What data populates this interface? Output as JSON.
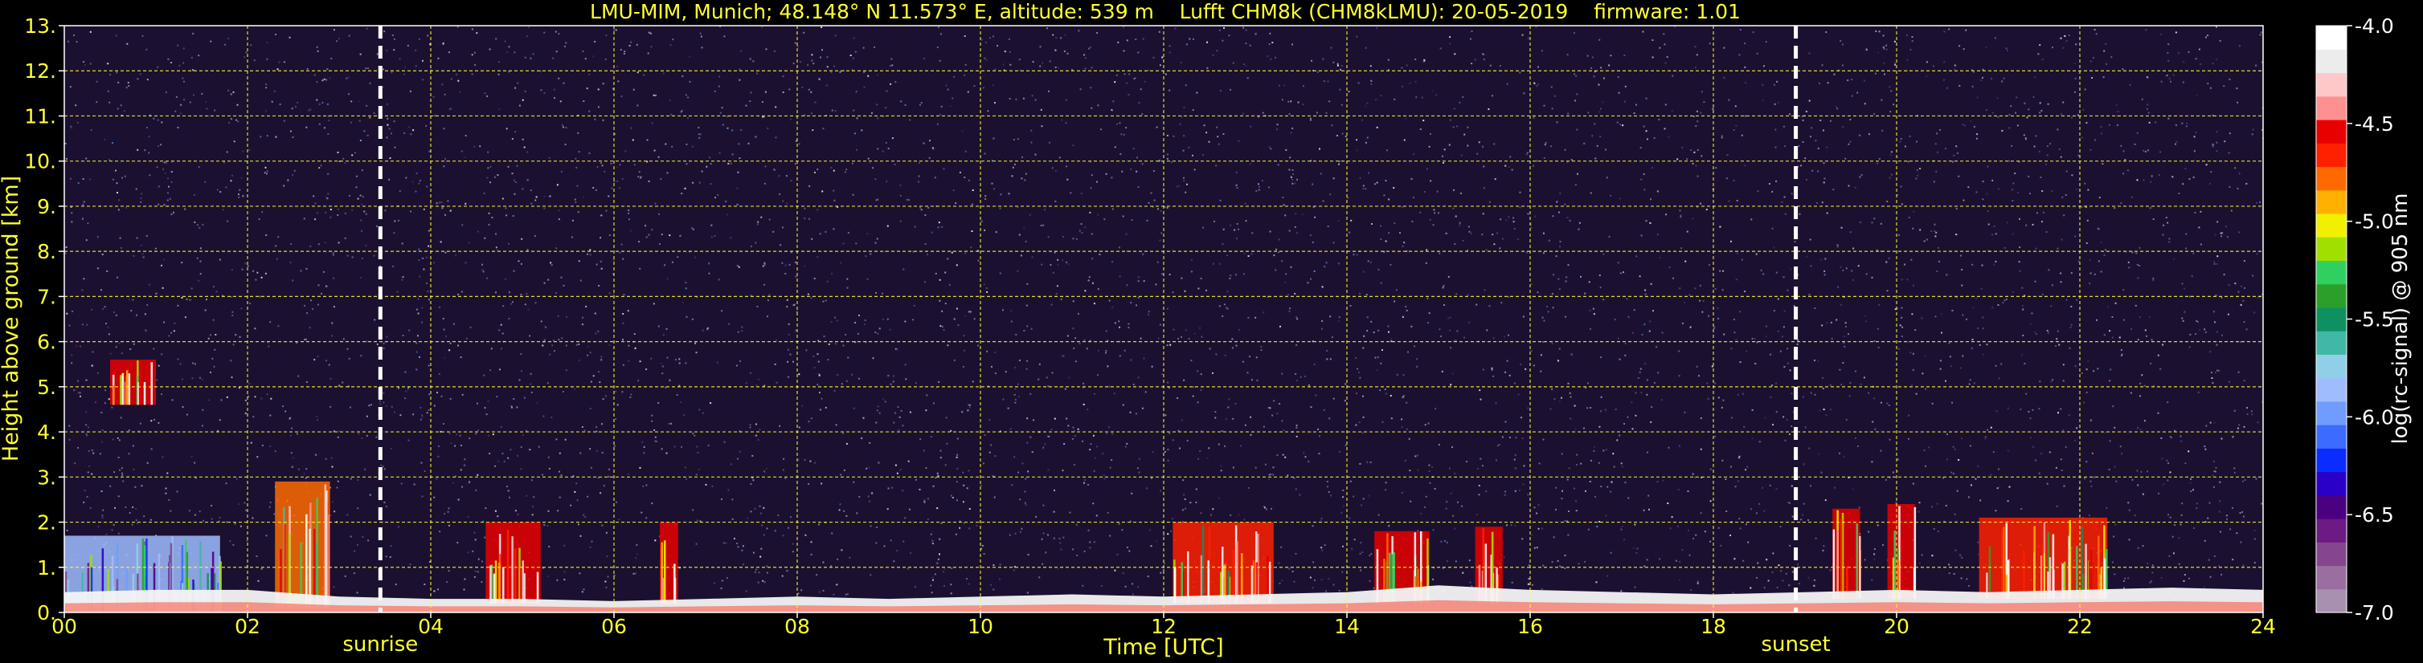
{
  "chart_data": {
    "type": "heatmap",
    "title": "LMU-MIM, Munich; 48.148° N 11.573° E, altitude: 539 m    Lufft CHM8k (CHM8kLMU): 20-05-2019    firmware: 1.01",
    "xlabel": "Time [UTC]",
    "ylabel": "Height above ground [km]",
    "xlim": [
      0,
      24
    ],
    "ylim": [
      0,
      13
    ],
    "x_ticks": [
      "00",
      "02",
      "04",
      "06",
      "08",
      "10",
      "12",
      "14",
      "16",
      "18",
      "20",
      "22",
      "24"
    ],
    "y_ticks": [
      "0.",
      "1.",
      "2.",
      "3.",
      "4.",
      "5.",
      "6.",
      "7.",
      "8.",
      "9.",
      "10.",
      "11.",
      "12.",
      "13."
    ],
    "grid": true,
    "colorbar": {
      "label": "log(rc-signal) @ 905 nm",
      "range": [
        -7.0,
        -4.0
      ],
      "ticks": [
        "-7.0",
        "-6.5",
        "-6.0",
        "-5.5",
        "-5.0",
        "-4.5",
        "-4.0"
      ],
      "tick_values": [
        -7.0,
        -6.5,
        -6.0,
        -5.5,
        -5.0,
        -4.5,
        -4.0
      ],
      "colors": [
        "#a890b0",
        "#9a6fa0",
        "#85468f",
        "#6d1a84",
        "#4b0082",
        "#2a00c8",
        "#0a2cff",
        "#3b6bff",
        "#6f9cff",
        "#9fbcff",
        "#8fd0e8",
        "#40b8a8",
        "#0f9060",
        "#2aa02a",
        "#30d060",
        "#a0e000",
        "#f0f000",
        "#ffb000",
        "#ff6a00",
        "#ff2000",
        "#e80000",
        "#ff9090",
        "#ffc8c8",
        "#ececec",
        "#ffffff"
      ]
    },
    "events": [
      {
        "name": "sunrise",
        "time": 3.45
      },
      {
        "name": "sunset",
        "time": 18.9
      }
    ],
    "boundary_layer_top_km": [
      [
        0.0,
        0.45
      ],
      [
        1.0,
        0.5
      ],
      [
        2.0,
        0.5
      ],
      [
        3.0,
        0.35
      ],
      [
        4.0,
        0.3
      ],
      [
        5.0,
        0.3
      ],
      [
        6.0,
        0.25
      ],
      [
        7.0,
        0.3
      ],
      [
        8.0,
        0.35
      ],
      [
        9.0,
        0.3
      ],
      [
        10.0,
        0.35
      ],
      [
        11.0,
        0.4
      ],
      [
        12.0,
        0.35
      ],
      [
        13.0,
        0.4
      ],
      [
        14.0,
        0.45
      ],
      [
        15.0,
        0.6
      ],
      [
        16.0,
        0.5
      ],
      [
        17.0,
        0.45
      ],
      [
        18.0,
        0.4
      ],
      [
        19.0,
        0.45
      ],
      [
        20.0,
        0.5
      ],
      [
        21.0,
        0.45
      ],
      [
        22.0,
        0.5
      ],
      [
        23.0,
        0.55
      ],
      [
        24.0,
        0.5
      ]
    ],
    "cloud_features": [
      {
        "t0": 0.0,
        "t1": 1.7,
        "base_km": 0.0,
        "top_km": 1.7,
        "level": -5.9
      },
      {
        "t0": 0.5,
        "t1": 1.0,
        "base_km": 4.6,
        "top_km": 5.6,
        "level": -4.6
      },
      {
        "t0": 2.3,
        "t1": 2.9,
        "base_km": 0.1,
        "top_km": 2.9,
        "level": -4.8
      },
      {
        "t0": 4.6,
        "t1": 5.2,
        "base_km": 0.2,
        "top_km": 2.0,
        "level": -4.5
      },
      {
        "t0": 6.5,
        "t1": 6.7,
        "base_km": 0.2,
        "top_km": 2.0,
        "level": -4.6
      },
      {
        "t0": 12.1,
        "t1": 13.2,
        "base_km": 0.2,
        "top_km": 2.0,
        "level": -4.7
      },
      {
        "t0": 14.3,
        "t1": 14.9,
        "base_km": 0.2,
        "top_km": 1.8,
        "level": -4.6
      },
      {
        "t0": 15.4,
        "t1": 15.7,
        "base_km": 0.2,
        "top_km": 1.9,
        "level": -4.6
      },
      {
        "t0": 19.3,
        "t1": 19.6,
        "base_km": 0.3,
        "top_km": 2.3,
        "level": -4.6
      },
      {
        "t0": 19.9,
        "t1": 20.2,
        "base_km": 0.3,
        "top_km": 2.4,
        "level": -4.6
      },
      {
        "t0": 20.9,
        "t1": 22.3,
        "base_km": 0.3,
        "top_km": 2.1,
        "level": -4.7
      }
    ]
  }
}
